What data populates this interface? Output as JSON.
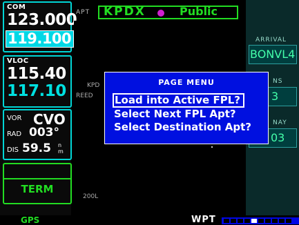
{
  "com": {
    "label": "COM",
    "active": "123.000",
    "standby": "119.100"
  },
  "vloc": {
    "label": "VLOC",
    "active": "115.40",
    "standby": "117.10"
  },
  "vor": {
    "label": "VOR",
    "ident": "CVO",
    "rad_label": "RAD",
    "radial": "003°",
    "dis_label": "DIS",
    "distance": "59.5",
    "distance_unit": "n m"
  },
  "cdi_mode": "TERM",
  "map": {
    "apt_label": "APT",
    "airport_id": "KPDX",
    "airport_type": "Public",
    "partial_k": "KPD",
    "partial_r": "REED",
    "scale": "200L"
  },
  "right_panel": {
    "arrival_label": "ARRIVAL",
    "arrival_value": "BONVL4",
    "field2_label": "NS",
    "field2_value": "3",
    "field3_label": "NAY",
    "field3_value": "03"
  },
  "popup": {
    "title": "PAGE MENU",
    "items": [
      "Load into Active FPL?",
      "Select Next FPL Apt?",
      "Select Destination Apt?"
    ],
    "selected_index": 0
  },
  "status_bar": {
    "mode": "GPS",
    "page_group": "WPT",
    "page_count": 10,
    "current_page": 4
  },
  "colors": {
    "accent_cyan": "#00d6d6",
    "nav_green": "#22dd22",
    "popup_blue": "#0010e0",
    "airport_magenta": "#d020d0"
  }
}
